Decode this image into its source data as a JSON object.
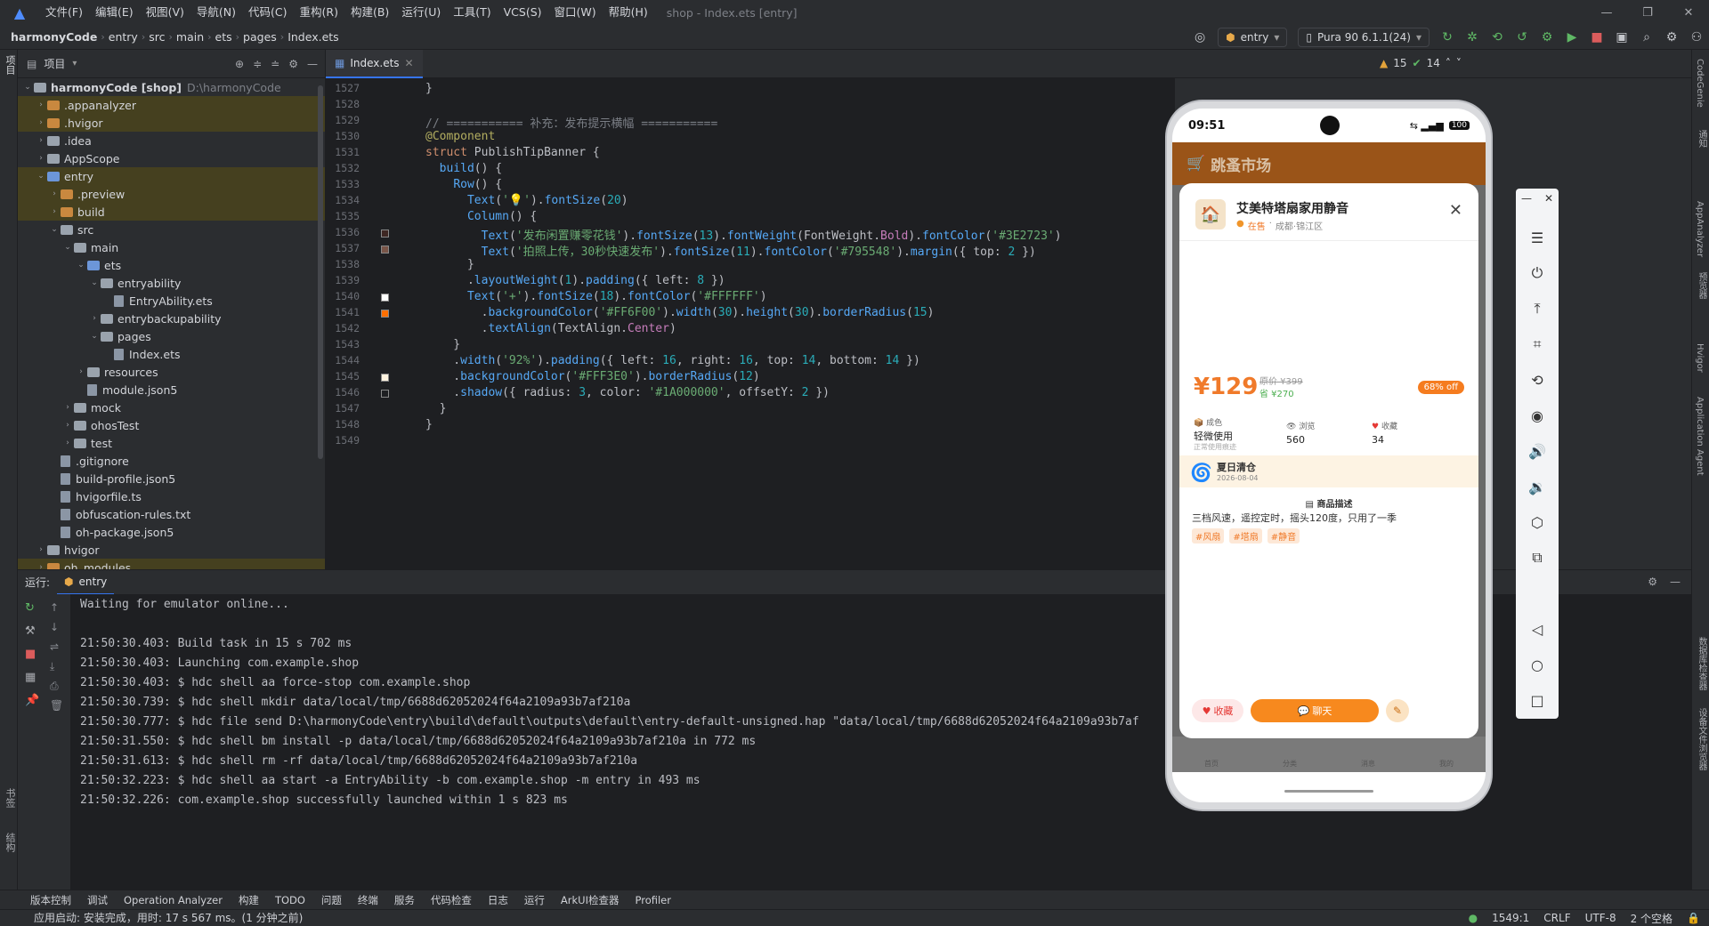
{
  "menu": {
    "items": [
      "文件(F)",
      "编辑(E)",
      "视图(V)",
      "导航(N)",
      "代码(C)",
      "重构(R)",
      "构建(B)",
      "运行(U)",
      "工具(T)",
      "VCS(S)",
      "窗口(W)",
      "帮助(H)"
    ],
    "window_title": "shop - Index.ets [entry]"
  },
  "breadcrumb": [
    "harmonyCode",
    "entry",
    "src",
    "main",
    "ets",
    "pages",
    "Index.ets"
  ],
  "toolbar": {
    "run_config": "entry",
    "device": "Pura 90 6.1.1(24)"
  },
  "project": {
    "title": "项目",
    "root": "harmonyCode [shop]",
    "root_path": "D:\\harmonyCode",
    "tree": [
      {
        "label": ".appanalyzer",
        "kind": "orange",
        "indent": 1,
        "arrow": "›",
        "sel": true
      },
      {
        "label": ".hvigor",
        "kind": "orange",
        "indent": 1,
        "arrow": "›",
        "sel": true
      },
      {
        "label": ".idea",
        "kind": "folder",
        "indent": 1,
        "arrow": "›"
      },
      {
        "label": "AppScope",
        "kind": "folder",
        "indent": 1,
        "arrow": "›"
      },
      {
        "label": "entry",
        "kind": "blue",
        "indent": 1,
        "arrow": "⌄",
        "sel": true
      },
      {
        "label": ".preview",
        "kind": "orange",
        "indent": 2,
        "arrow": "›",
        "sel": true
      },
      {
        "label": "build",
        "kind": "orange",
        "indent": 2,
        "arrow": "›",
        "sel": true
      },
      {
        "label": "src",
        "kind": "folder",
        "indent": 2,
        "arrow": "⌄"
      },
      {
        "label": "main",
        "kind": "folder",
        "indent": 3,
        "arrow": "⌄"
      },
      {
        "label": "ets",
        "kind": "blue",
        "indent": 4,
        "arrow": "⌄"
      },
      {
        "label": "entryability",
        "kind": "folder",
        "indent": 5,
        "arrow": "⌄"
      },
      {
        "label": "EntryAbility.ets",
        "kind": "file",
        "indent": 6,
        "arrow": ""
      },
      {
        "label": "entrybackupability",
        "kind": "folder",
        "indent": 5,
        "arrow": "›"
      },
      {
        "label": "pages",
        "kind": "folder",
        "indent": 5,
        "arrow": "⌄"
      },
      {
        "label": "Index.ets",
        "kind": "file",
        "indent": 6,
        "arrow": ""
      },
      {
        "label": "resources",
        "kind": "folder",
        "indent": 4,
        "arrow": "›"
      },
      {
        "label": "module.json5",
        "kind": "file",
        "indent": 4,
        "arrow": ""
      },
      {
        "label": "mock",
        "kind": "folder",
        "indent": 3,
        "arrow": "›"
      },
      {
        "label": "ohosTest",
        "kind": "folder",
        "indent": 3,
        "arrow": "›"
      },
      {
        "label": "test",
        "kind": "folder",
        "indent": 3,
        "arrow": "›"
      },
      {
        "label": ".gitignore",
        "kind": "file",
        "indent": 2,
        "arrow": ""
      },
      {
        "label": "build-profile.json5",
        "kind": "file",
        "indent": 2,
        "arrow": ""
      },
      {
        "label": "hvigorfile.ts",
        "kind": "file",
        "indent": 2,
        "arrow": ""
      },
      {
        "label": "obfuscation-rules.txt",
        "kind": "file",
        "indent": 2,
        "arrow": ""
      },
      {
        "label": "oh-package.json5",
        "kind": "file",
        "indent": 2,
        "arrow": ""
      },
      {
        "label": "hvigor",
        "kind": "folder",
        "indent": 1,
        "arrow": "›"
      },
      {
        "label": "oh_modules",
        "kind": "orange",
        "indent": 1,
        "arrow": "›",
        "sel": true
      }
    ]
  },
  "editor": {
    "tab": "Index.ets",
    "inspection": {
      "warnings": "15",
      "checks": "14"
    },
    "lines": [
      {
        "n": "1527",
        "h": "<span>}</span>"
      },
      {
        "n": "1528",
        "h": ""
      },
      {
        "n": "1529",
        "h": "<span class='c'>// =========== 补充：发布提示横幅 ===========</span>"
      },
      {
        "n": "1530",
        "h": "<span class='a'>@Component</span>"
      },
      {
        "n": "1531",
        "h": "<span class='k'>struct</span> <span>PublishTipBanner</span> {"
      },
      {
        "n": "1532",
        "h": "  <span class='f'>build</span>() {"
      },
      {
        "n": "1533",
        "h": "    <span class='f'>Row</span>() {"
      },
      {
        "n": "1534",
        "h": "      <span class='f'>Text</span>(<span class='s'>'💡'</span>).<span class='f'>fontSize</span>(<span class='n'>20</span>)"
      },
      {
        "n": "1535",
        "h": "      <span class='f'>Column</span>() {"
      },
      {
        "n": "1536",
        "h": "        <span class='f'>Text</span>(<span class='s'>'发布闲置赚零花钱'</span>).<span class='f'>fontSize</span>(<span class='n'>13</span>).<span class='f'>fontWeight</span>(FontWeight.<span class='p'>Bold</span>).<span class='f'>fontColor</span>(<span class='s'>'#3E2723'</span>)"
      },
      {
        "n": "1537",
        "h": "        <span class='f'>Text</span>(<span class='s'>'拍照上传，30秒快速发布'</span>).<span class='f'>fontSize</span>(<span class='n'>11</span>).<span class='f'>fontColor</span>(<span class='s'>'#795548'</span>).<span class='f'>margin</span>({ top: <span class='n'>2</span> })"
      },
      {
        "n": "1538",
        "h": "      }"
      },
      {
        "n": "1539",
        "h": "      .<span class='f'>layoutWeight</span>(<span class='n'>1</span>).<span class='f'>padding</span>({ left: <span class='n'>8</span> })"
      },
      {
        "n": "1540",
        "h": "      <span class='f'>Text</span>(<span class='s'>'+'</span>).<span class='f'>fontSize</span>(<span class='n'>18</span>).<span class='f'>fontColor</span>(<span class='s'>'#FFFFFF'</span>)"
      },
      {
        "n": "1541",
        "h": "        .<span class='f'>backgroundColor</span>(<span class='s'>'#FF6F00'</span>).<span class='f'>width</span>(<span class='n'>30</span>).<span class='f'>height</span>(<span class='n'>30</span>).<span class='f'>borderRadius</span>(<span class='n'>15</span>)"
      },
      {
        "n": "1542",
        "h": "        .<span class='f'>textAlign</span>(TextAlign.<span class='p'>Center</span>)"
      },
      {
        "n": "1543",
        "h": "    }"
      },
      {
        "n": "1544",
        "h": "    .<span class='f'>width</span>(<span class='s'>'92%'</span>).<span class='f'>padding</span>({ left: <span class='n'>16</span>, right: <span class='n'>16</span>, top: <span class='n'>14</span>, bottom: <span class='n'>14</span> })"
      },
      {
        "n": "1545",
        "h": "    .<span class='f'>backgroundColor</span>(<span class='s'>'#FFF3E0'</span>).<span class='f'>borderRadius</span>(<span class='n'>12</span>)"
      },
      {
        "n": "1546",
        "h": "    .<span class='f'>shadow</span>({ radius: <span class='n'>3</span>, color: <span class='s'>'#1A000000'</span>, offsetY: <span class='n'>2</span> })"
      },
      {
        "n": "1547",
        "h": "  }"
      },
      {
        "n": "1548",
        "h": "}"
      },
      {
        "n": "1549",
        "h": ""
      }
    ]
  },
  "run": {
    "label": "运行:",
    "tab": "entry",
    "lines": [
      "Waiting for emulator online...",
      "",
      "21:50:30.403: Build task in 15 s 702 ms",
      "21:50:30.403: Launching com.example.shop",
      "21:50:30.403: $ hdc shell aa force-stop com.example.shop",
      "21:50:30.739: $ hdc shell mkdir data/local/tmp/6688d62052024f64a2109a93b7af210a",
      "21:50:30.777: $ hdc file send D:\\harmonyCode\\entry\\build\\default\\outputs\\default\\entry-default-unsigned.hap \"data/local/tmp/6688d62052024f64a2109a93b7af",
      "21:50:31.550: $ hdc shell bm install -p data/local/tmp/6688d62052024f64a2109a93b7af210a in 772 ms",
      "21:50:31.613: $ hdc shell rm -rf data/local/tmp/6688d62052024f64a2109a93b7af210a",
      "21:50:32.223: $ hdc shell aa start -a EntryAbility -b com.example.shop -m entry in 493 ms",
      "21:50:32.226: com.example.shop successfully launched within 1 s 823 ms"
    ]
  },
  "bottom_tools": [
    "版本控制",
    "调试",
    "Operation Analyzer",
    "构建",
    "TODO",
    "问题",
    "终端",
    "服务",
    "代码检查",
    "日志",
    "运行",
    "ArkUI检查器",
    "Profiler"
  ],
  "status": {
    "message": "应用启动: 安装完成，用时: 17 s 567 ms。(1 分钟之前)",
    "position": "1549:1",
    "line_sep": "CRLF",
    "encoding": "UTF-8",
    "indent": "2 个空格"
  },
  "left_strip": [
    "项目",
    "书签",
    "结构"
  ],
  "right_strip": [
    "CodeGenie",
    "通知",
    "AppAnalyzer",
    "预览器",
    "Hvigor",
    "Application Agent",
    "数据库检查器",
    "设备文件浏览器"
  ],
  "phone": {
    "time": "09:51",
    "battery": "100",
    "app_title": "跳蚤市场",
    "product": {
      "title": "艾美特塔扇家用静音",
      "status": "在售",
      "location": "成都·锦江区",
      "price": "¥129",
      "orig_price": "原价 ¥399",
      "save": "省 ¥270",
      "discount": "68% off",
      "condition_label": "成色",
      "condition": "轻微使用",
      "condition_note": "正常使用痕迹",
      "views_label": "浏览",
      "views": "560",
      "fav_label": "收藏",
      "favs": "34",
      "seller": "夏日清仓",
      "date": "2026-08-04",
      "desc_title": "商品描述",
      "desc": "三档风速，遥控定时，摇头120度，只用了一季",
      "tags": [
        "#风扇",
        "#塔扇",
        "#静音"
      ]
    },
    "actions": {
      "fav": "收藏",
      "chat": "聊天"
    },
    "tabs": [
      "首页",
      "分类",
      "消息",
      "我的"
    ]
  }
}
